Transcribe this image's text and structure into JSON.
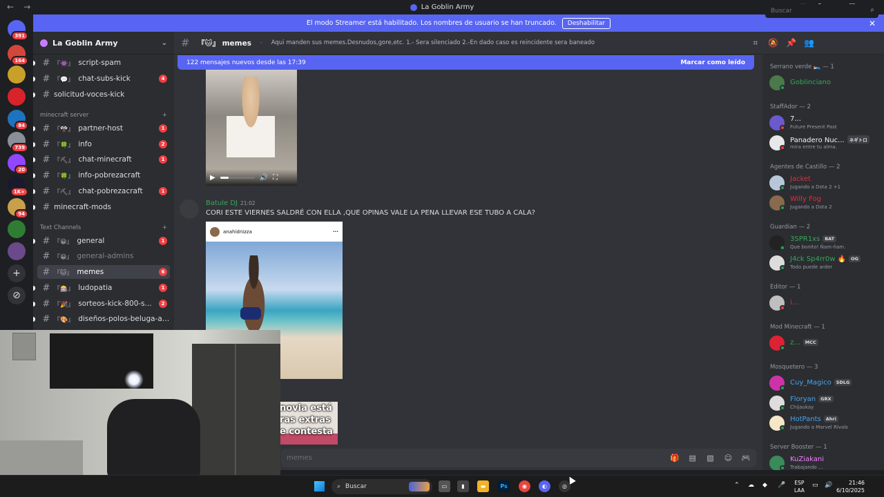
{
  "window": {
    "title": "La Goblin Army",
    "nav_back": "←",
    "nav_fwd": "→"
  },
  "banner": {
    "text": "El modo Streamer está habilitado. Los nombres de usuario se han truncado.",
    "button": "Deshabilitar",
    "close": "✕"
  },
  "server_rail": {
    "badges": [
      "391",
      "164",
      "84",
      "739",
      "20",
      "1K+",
      "94"
    ]
  },
  "guild": {
    "name": "La Goblin Army"
  },
  "channels": [
    {
      "emoji": "『👾』",
      "name": "script-spam",
      "badge": ""
    },
    {
      "emoji": "『💬』",
      "name": "chat-subs-kick",
      "badge": "4"
    },
    {
      "emoji": "",
      "name": "solicitud-voces-kick",
      "badge": ""
    }
  ],
  "categories": {
    "minecraft": "minecraft server",
    "text": "Text Channels"
  },
  "minecraft_channels": [
    {
      "emoji": "『🎌』",
      "name": "partner-host",
      "badge": "1"
    },
    {
      "emoji": "『🍀』",
      "name": "info",
      "badge": "2"
    },
    {
      "emoji": "『⛏』",
      "name": "chat-minecraft",
      "badge": "1"
    },
    {
      "emoji": "『🍀』",
      "name": "info-pobrezacraft",
      "badge": ""
    },
    {
      "emoji": "『⛏』",
      "name": "chat-pobrezacraft",
      "badge": "1"
    },
    {
      "emoji": "",
      "name": "minecraft-mods",
      "badge": ""
    }
  ],
  "text_channels": [
    {
      "emoji": "『😀』",
      "name": "general",
      "badge": "1"
    },
    {
      "emoji": "『😀』",
      "name": "general-admins",
      "badge": ""
    },
    {
      "emoji": "『🐱』",
      "name": "memes",
      "badge": "6"
    },
    {
      "emoji": "『🎰』",
      "name": "ludopatia",
      "badge": "1"
    },
    {
      "emoji": "『🎉』",
      "name": "sorteos-kick-800-s...",
      "badge": "2"
    },
    {
      "emoji": "『🎨』",
      "name": "diseños-polos-beluga-ar...",
      "badge": ""
    }
  ],
  "topbar": {
    "channel": "『🐱』 memes",
    "topic": "Aqui manden sus memes.Desnudos,gore,etc. 1.- Sera silenciado 2.-En dado caso es reincidente sera baneado",
    "search_placeholder": "Buscar"
  },
  "new_messages": {
    "text": "122 mensajes nuevos desde las 17:39",
    "action": "Marcar como leído"
  },
  "message": {
    "author": "Batule DJ",
    "time": "21:02",
    "content": "CORI ESTE VIERNES SALDRÉ CON ELLA ,QUE OPINAS VALE LA PENA LLEVAR ESE TUBO A CALA?",
    "ig_user": "anahidnizza",
    "ig_more": "···"
  },
  "video": {
    "progress": 0.25
  },
  "meme_text": [
    "novia está",
    "ras extras",
    "e contesta"
  ],
  "composer": {
    "placeholder": "memes"
  },
  "members": {
    "groups": [
      {
        "title": "Serrano verde 🛌 — 1",
        "members": [
          {
            "name": "Goblinciano",
            "status": "",
            "color": "#3ba55c",
            "tag": ""
          }
        ]
      },
      {
        "title": "StaffAdor — 2",
        "members": [
          {
            "name": "7...",
            "status": "Future Present Past",
            "color": "#f2f3f5",
            "tag": ""
          },
          {
            "name": "Panadero Nuc...",
            "status": "mira entre tu alma.",
            "color": "#f2f3f5",
            "tag": "ネギトロ"
          }
        ]
      },
      {
        "title": "Agentes de Castillo — 2",
        "members": [
          {
            "name": "Jacket",
            "status": "Jugando a Dota 2 +1",
            "color": "#e0313f",
            "tag": ""
          },
          {
            "name": "Willy Fog",
            "status": "Jugando a Dota 2",
            "color": "#e0313f",
            "tag": ""
          }
        ]
      },
      {
        "title": "Guardian — 2",
        "members": [
          {
            "name": "3SPR1xs",
            "status": "Que bonito! Ñam-ñam.",
            "color": "#3ba55c",
            "tag": "BAT"
          },
          {
            "name": "J4ck Sp4rr0w 🔥",
            "status": "Todo puede arder",
            "color": "#3ba55c",
            "tag": "OG"
          }
        ]
      },
      {
        "title": "Editor — 1",
        "members": [
          {
            "name": "i...",
            "status": "",
            "color": "#e0313f",
            "tag": ""
          }
        ]
      },
      {
        "title": "Mod Minecraft — 1",
        "members": [
          {
            "name": "z...",
            "status": "",
            "color": "#3ba55c",
            "tag": "MCC"
          }
        ]
      },
      {
        "title": "Mosquetero — 3",
        "members": [
          {
            "name": "Cuy_Magico",
            "status": "",
            "color": "#4aa3f0",
            "tag": "SDLG"
          },
          {
            "name": "Floryan",
            "status": "Chijaukay",
            "color": "#4aa3f0",
            "tag": "GRX"
          },
          {
            "name": "HotPants",
            "status": "Jugando a Marvel Rivals",
            "color": "#4aa3f0",
            "tag": "Ahri"
          }
        ]
      },
      {
        "title": "Server Booster — 1",
        "members": [
          {
            "name": "KuZiakani",
            "status": "Trabajando ...",
            "color": "#f47fff",
            "tag": ""
          }
        ]
      }
    ]
  },
  "taskbar": {
    "search": "Buscar",
    "lang": "ESP",
    "lang2": "LAA",
    "time": "21:46",
    "date": "6/10/2025"
  }
}
